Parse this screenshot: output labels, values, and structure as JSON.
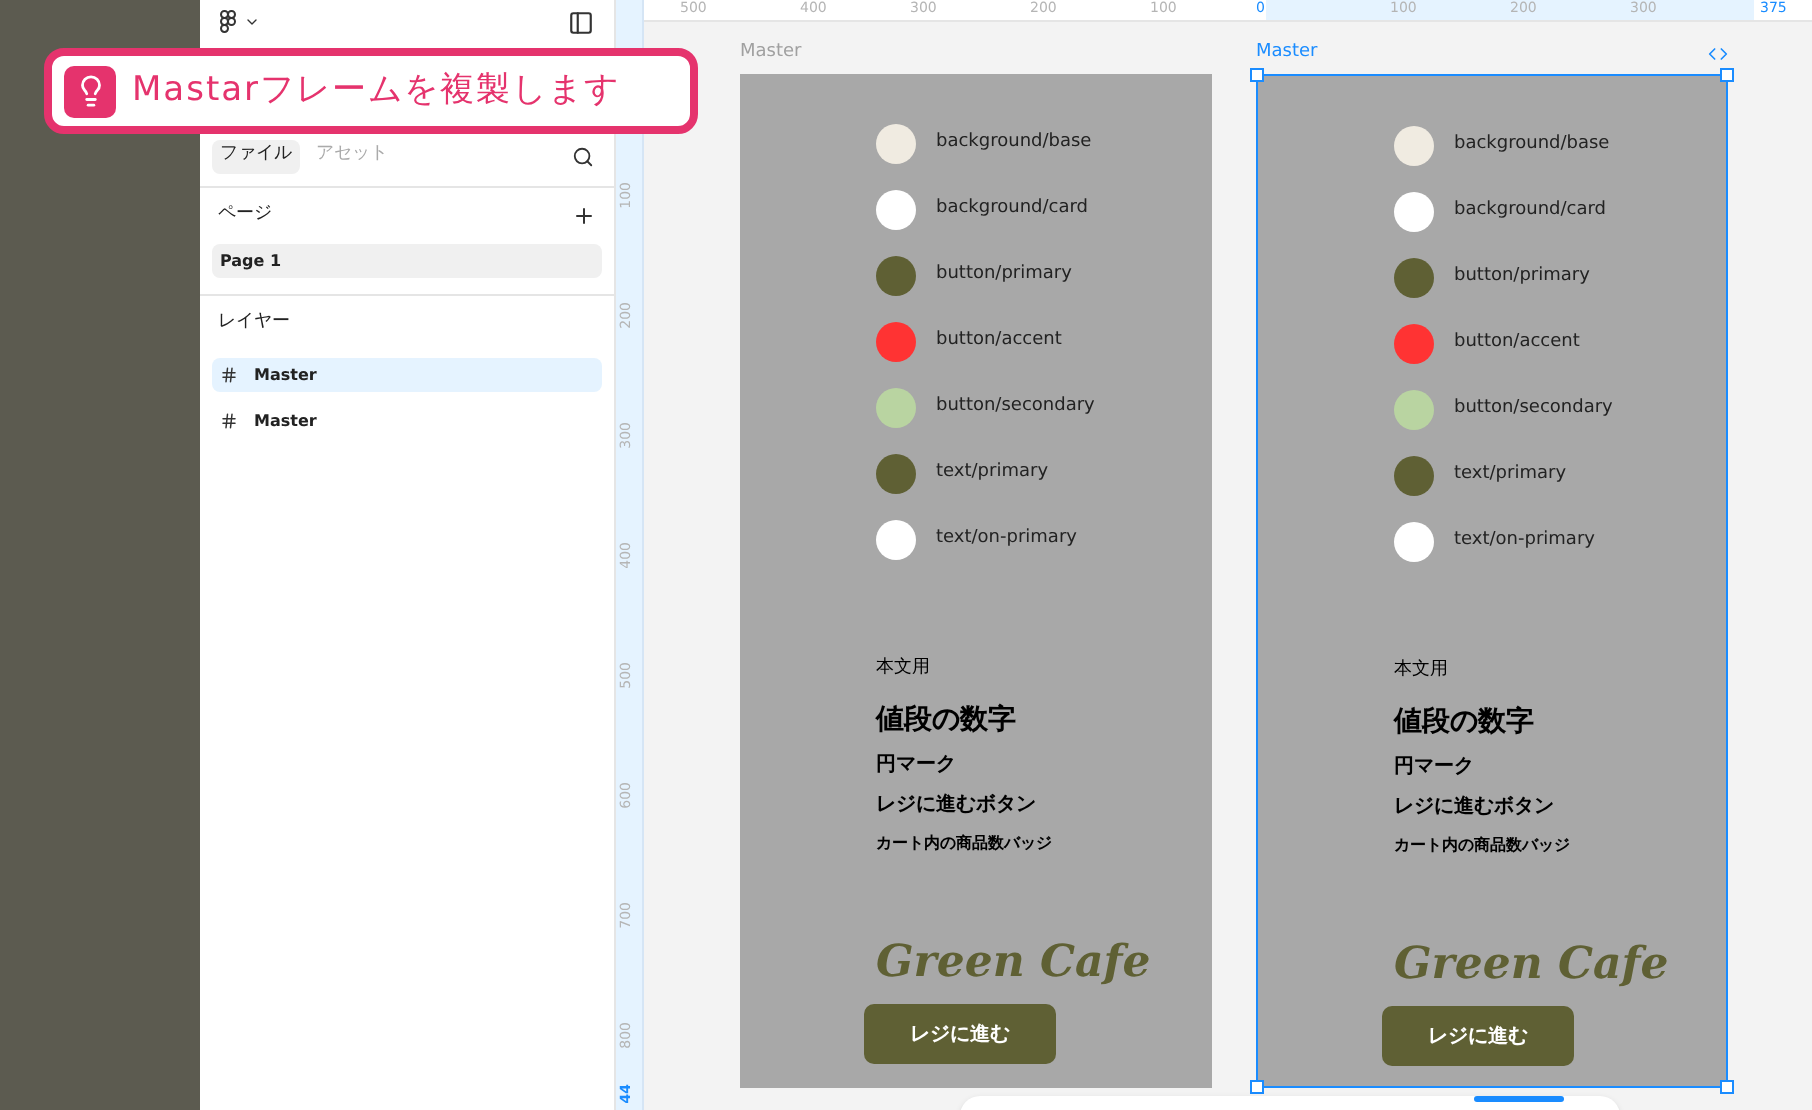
{
  "callout": {
    "text": "Mastarフレームを複製します"
  },
  "sidebar_tabs": [
    {
      "label": "ファイル",
      "selected": true
    },
    {
      "label": "アセット",
      "selected": false
    }
  ],
  "pages": {
    "title": "ページ",
    "items": [
      {
        "label": "Page 1",
        "selected": true
      }
    ]
  },
  "layers": {
    "title": "レイヤー",
    "items": [
      {
        "label": "Master",
        "selected": true
      },
      {
        "label": "Master",
        "selected": false
      }
    ]
  },
  "rulers": {
    "top": [
      {
        "label": "500",
        "selected": false
      },
      {
        "label": "400",
        "selected": false
      },
      {
        "label": "300",
        "selected": false
      },
      {
        "label": "200",
        "selected": false
      },
      {
        "label": "100",
        "selected": false
      },
      {
        "label": "0",
        "selected": true
      },
      {
        "label": "100",
        "selected": false
      },
      {
        "label": "200",
        "selected": false
      },
      {
        "label": "300",
        "selected": false
      },
      {
        "label": "375",
        "selected": true
      }
    ],
    "left": [
      {
        "label": "100",
        "selected": false
      },
      {
        "label": "200",
        "selected": false
      },
      {
        "label": "300",
        "selected": false
      },
      {
        "label": "400",
        "selected": false
      },
      {
        "label": "500",
        "selected": false
      },
      {
        "label": "600",
        "selected": false
      },
      {
        "label": "700",
        "selected": false
      },
      {
        "label": "800",
        "selected": false
      },
      {
        "label": "44",
        "selected": true
      }
    ]
  },
  "frames": [
    {
      "label": "Master",
      "selected": false,
      "swatches": [
        {
          "name": "background/base",
          "color": "#f0ebe1"
        },
        {
          "name": "background/card",
          "color": "#ffffff"
        },
        {
          "name": "button/primary",
          "color": "#5f6034"
        },
        {
          "name": "button/accent",
          "color": "#ff3333"
        },
        {
          "name": "button/secondary",
          "color": "#b9d4a1"
        },
        {
          "name": "text/primary",
          "color": "#5f6034"
        },
        {
          "name": "text/on-primary",
          "color": "#ffffff"
        }
      ],
      "type_samples": [
        {
          "text": "本文用",
          "kind": "body"
        },
        {
          "text": "値段の数字",
          "kind": "price"
        },
        {
          "text": "円マーク",
          "kind": "label"
        },
        {
          "text": "レジに進むボタン",
          "kind": "label"
        },
        {
          "text": "カート内の商品数バッジ",
          "kind": "badge"
        }
      ],
      "logo": "Green Cafe",
      "button": "レジに進む"
    },
    {
      "label": "Master",
      "selected": true,
      "swatches": [
        {
          "name": "background/base",
          "color": "#f0ebe1"
        },
        {
          "name": "background/card",
          "color": "#ffffff"
        },
        {
          "name": "button/primary",
          "color": "#5f6034"
        },
        {
          "name": "button/accent",
          "color": "#ff3333"
        },
        {
          "name": "button/secondary",
          "color": "#b9d4a1"
        },
        {
          "name": "text/primary",
          "color": "#5f6034"
        },
        {
          "name": "text/on-primary",
          "color": "#ffffff"
        }
      ],
      "type_samples": [
        {
          "text": "本文用",
          "kind": "body"
        },
        {
          "text": "値段の数字",
          "kind": "price"
        },
        {
          "text": "円マーク",
          "kind": "label"
        },
        {
          "text": "レジに進むボタン",
          "kind": "label"
        },
        {
          "text": "カート内の商品数バッジ",
          "kind": "badge"
        }
      ],
      "logo": "Green Cafe",
      "button": "レジに進む"
    }
  ]
}
